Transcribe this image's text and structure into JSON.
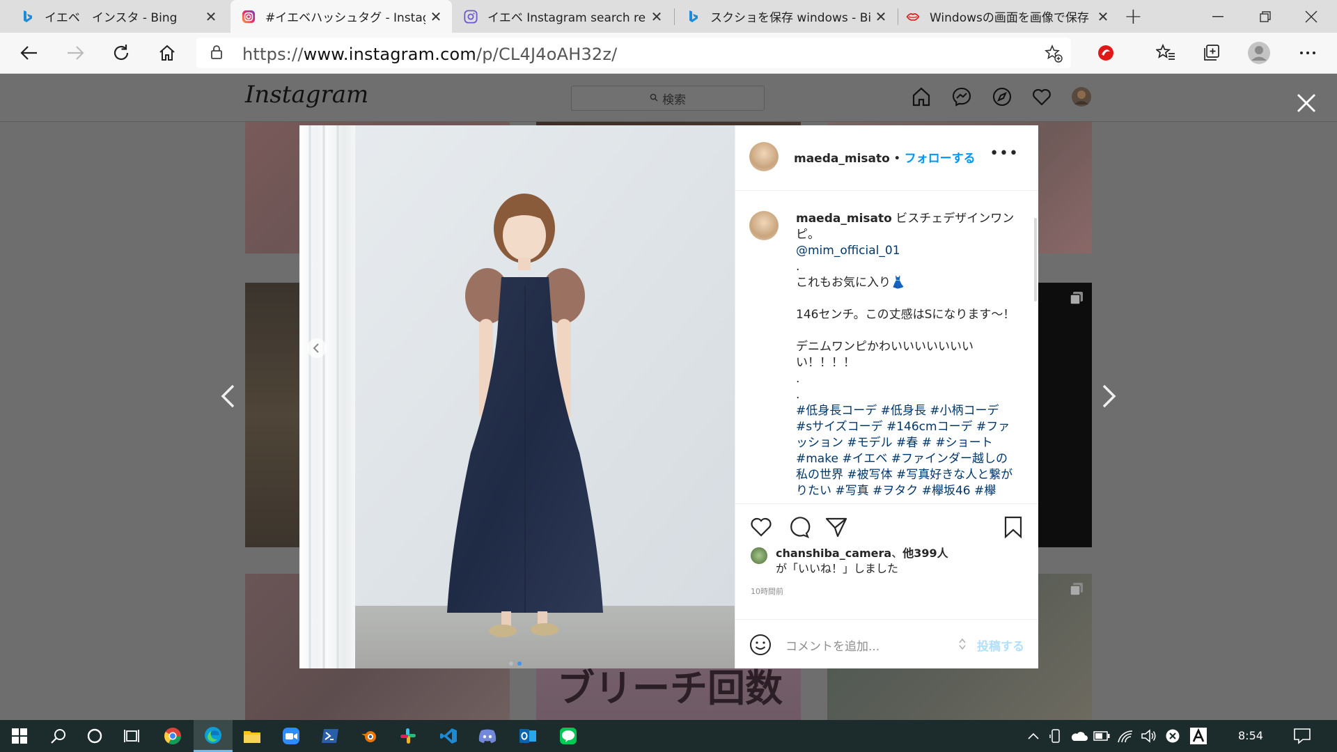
{
  "browser": {
    "tabs": [
      {
        "title": "イエベ　インスタ - Bing",
        "icon": "bing-icon",
        "active": false
      },
      {
        "title": "#イエベハッシュタグ - Instagram",
        "icon": "instagram-icon",
        "active": true
      },
      {
        "title": "イエベ Instagram search results",
        "icon": "instagram-outline-icon",
        "active": false
      },
      {
        "title": "スクショを保存 windows - Bing",
        "icon": "bing-icon",
        "active": false
      },
      {
        "title": "Windowsの画面を画像で保存",
        "icon": "lips-icon",
        "active": false
      }
    ],
    "close_glyph": "✕",
    "new_tab_glyph": "+",
    "url_prefix": "https://",
    "url_host": "www.instagram.com",
    "url_path": "/p/CL4J4oAH32z/"
  },
  "instagram": {
    "logo": "Instagram",
    "search_placeholder": "検索",
    "modal": {
      "username": "maeda_misato",
      "follow_sep": " • ",
      "follow_label": "フォローする",
      "more_label": "•••",
      "caption_lines": [
        {
          "text": "ビスチェデザインワンピ。",
          "kind": "text"
        },
        {
          "text": "@mim_official_01",
          "kind": "link"
        },
        {
          "text": ".",
          "kind": "text"
        },
        {
          "text": "これもお気に入り👗",
          "kind": "text"
        },
        {
          "text": "",
          "kind": "text"
        },
        {
          "text": "146センチ。この丈感はSになります〜！",
          "kind": "text"
        },
        {
          "text": "",
          "kind": "text"
        },
        {
          "text": "デニムワンピかわいいいいいいいい！！！！",
          "kind": "text"
        },
        {
          "text": ".",
          "kind": "text"
        },
        {
          "text": ".",
          "kind": "text"
        },
        {
          "text": "#低身長コーデ #低身長 #小柄コーデ #sサイズコーデ #146cmコーデ #ファッション #モデル #春 # #ショート #make #イエベ #ファインダー越しの私の世界 #被写体 #写真好きな人と繋がりたい #写真 #ヲタク #欅坂46 #欅",
          "kind": "link"
        }
      ],
      "likes_user": "chanshiba_camera",
      "likes_sep": "、",
      "likes_others": "他399人",
      "likes_suffix": "が「いいね！」しました",
      "time": "10時間前",
      "comment_placeholder": "コメントを追加...",
      "post_label": "投稿する"
    }
  },
  "thumbs_text": {
    "bottom_middle": "ブリーチ回数"
  },
  "taskbar": {
    "clock": "8:54"
  }
}
